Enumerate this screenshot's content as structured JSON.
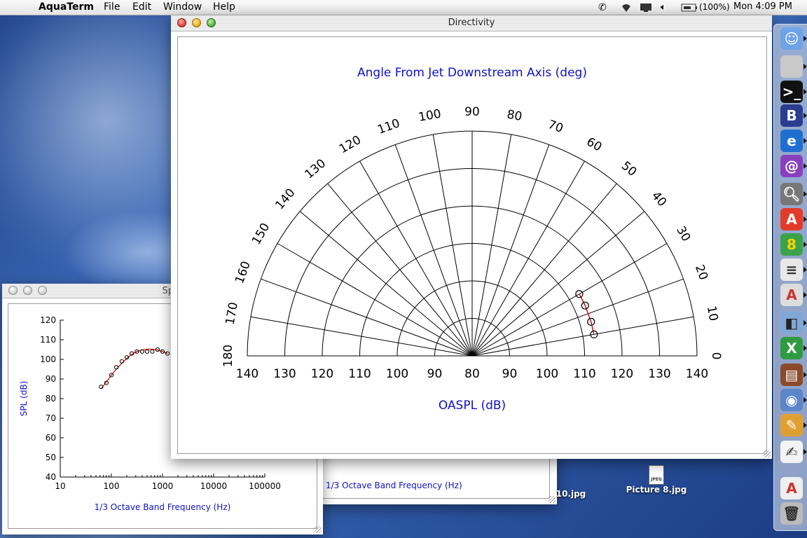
{
  "menubar": {
    "app_name": "AquaTerm",
    "items": [
      "File",
      "Edit",
      "Window",
      "Help"
    ],
    "battery": "(100%)",
    "clock": "Mon 4:09 PM"
  },
  "windows": {
    "spectrum_title": "Spectrum for Ol",
    "back_window_xlabel": "1/3 Octave Band Frequency (Hz)",
    "directivity_title": "Directivity"
  },
  "desktop_icons": [
    {
      "label": "10.jpg"
    },
    {
      "label": "Picture 8.jpg",
      "badge": "JPEG"
    }
  ],
  "dock_icons": [
    "finder-icon",
    "system-prefs-icon",
    "terminal-icon",
    "bbedit-icon",
    "internet-explorer-icon",
    "eudora-icon",
    "sherlock-icon",
    "acrobat-icon",
    "aquaterm-icon",
    "textedit-icon",
    "preview-icon",
    "project-icon",
    "excel-icon",
    "stuffit-icon",
    "iphoto-icon",
    "pen-icon",
    "note-icon",
    "pdf-doc-icon",
    "trash-icon"
  ],
  "colors": {
    "label_blue": "#1010c8",
    "curve_red": "#dd0000"
  },
  "chart_data": [
    {
      "type": "polar",
      "title": "Angle From Jet Downstream Axis (deg)",
      "xlabel": "OASPL (dB)",
      "angle_ticks": [
        0,
        10,
        20,
        30,
        40,
        50,
        60,
        70,
        80,
        90,
        100,
        110,
        120,
        130,
        140,
        150,
        160,
        170,
        180
      ],
      "radial_ticks": [
        "140",
        "130",
        "120",
        "110",
        "100",
        "90",
        "80",
        "90",
        "100",
        "110",
        "120",
        "130",
        "140"
      ],
      "r_range": [
        80,
        140
      ],
      "series": [
        {
          "angles": [
            30,
            24,
            16,
            10
          ],
          "values": [
            113,
            113,
            113,
            113
          ]
        }
      ]
    },
    {
      "type": "scatter",
      "ylabel": "SPL (dB)",
      "xlabel": "1/3 Octave Band Frequency (Hz)",
      "x_scale": "log",
      "xticks": [
        "10",
        "100",
        "1000",
        "10000",
        "100000"
      ],
      "yticks": [
        "40",
        "50",
        "60",
        "70",
        "80",
        "90",
        "100",
        "110",
        "120"
      ],
      "ylim": [
        40,
        120
      ],
      "points": [
        [
          63,
          86
        ],
        [
          80,
          88
        ],
        [
          100,
          92
        ],
        [
          125,
          96
        ],
        [
          160,
          99
        ],
        [
          200,
          101
        ],
        [
          250,
          103
        ],
        [
          315,
          104
        ],
        [
          400,
          104
        ],
        [
          500,
          104
        ],
        [
          630,
          104
        ],
        [
          800,
          105
        ],
        [
          1000,
          104
        ],
        [
          1250,
          103
        ]
      ],
      "fit": [
        [
          63,
          85
        ],
        [
          80,
          88.5
        ],
        [
          100,
          92
        ],
        [
          125,
          95
        ],
        [
          160,
          98
        ],
        [
          200,
          100.5
        ],
        [
          250,
          102.5
        ],
        [
          315,
          104
        ],
        [
          400,
          104.8
        ],
        [
          500,
          105.2
        ],
        [
          630,
          105.2
        ],
        [
          800,
          104.8
        ],
        [
          1000,
          104
        ],
        [
          1250,
          103
        ]
      ]
    }
  ]
}
